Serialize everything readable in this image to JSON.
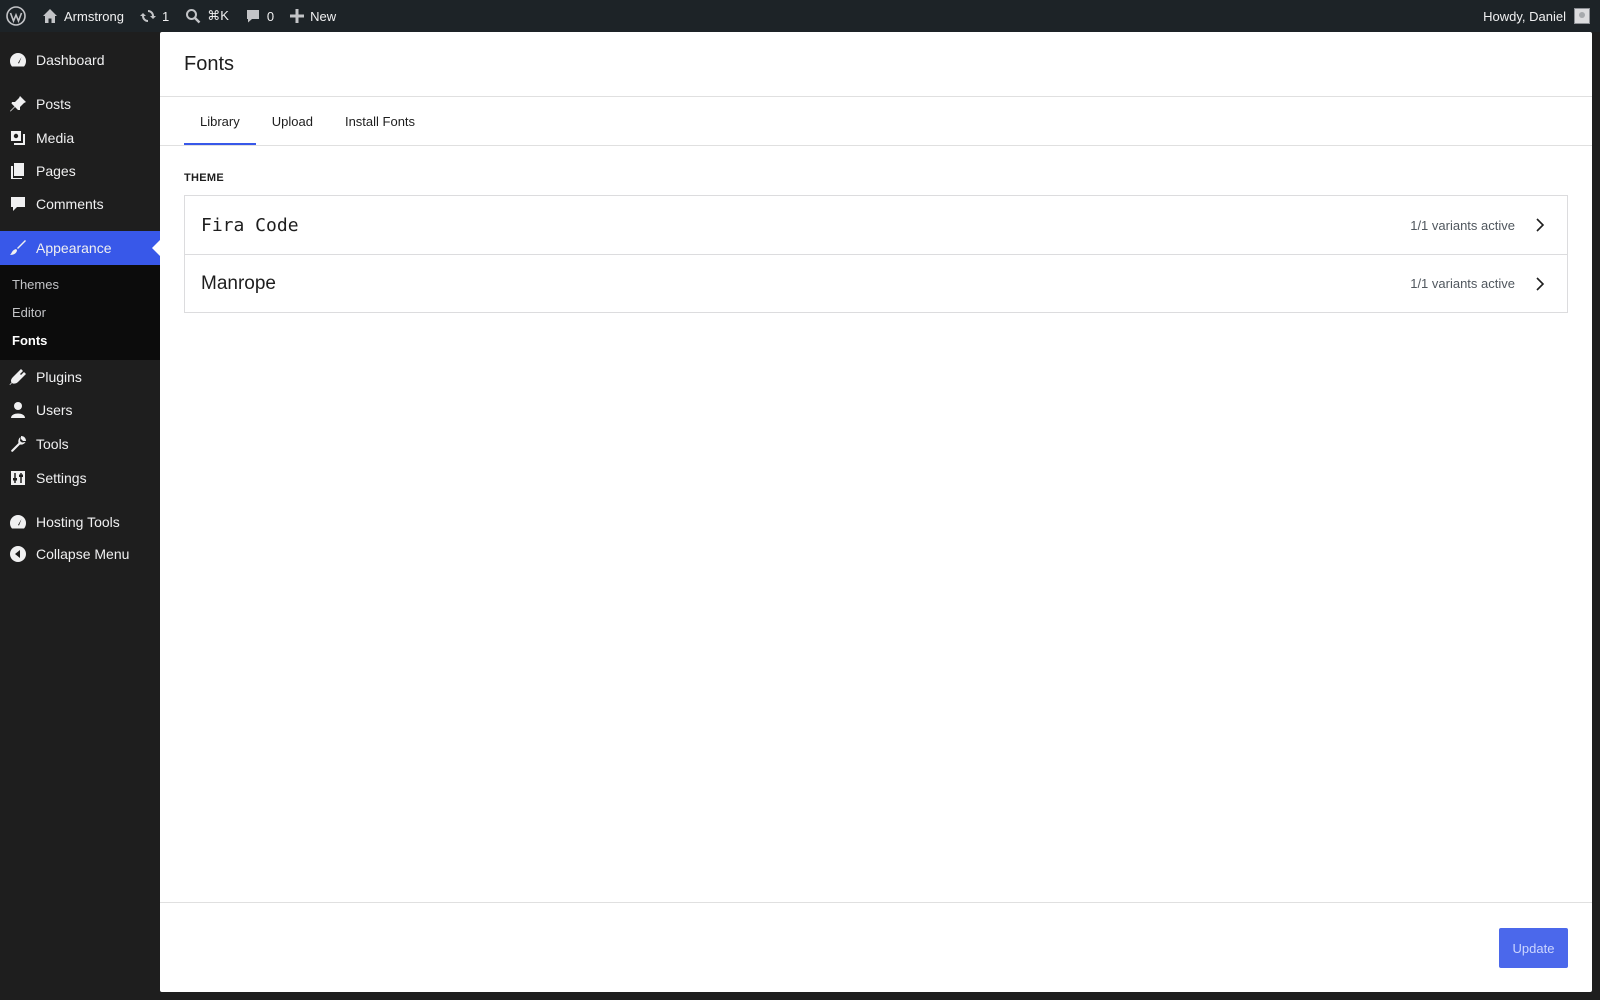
{
  "adminbar": {
    "site_name": "Armstrong",
    "updates_count": "1",
    "search_shortcut": "⌘K",
    "comments_count": "0",
    "new_label": "New",
    "greeting": "Howdy, Daniel"
  },
  "sidebar": {
    "items": [
      {
        "label": "Dashboard",
        "icon": "dashboard-icon"
      },
      {
        "label": "Posts",
        "icon": "pin-icon"
      },
      {
        "label": "Media",
        "icon": "media-icon"
      },
      {
        "label": "Pages",
        "icon": "pages-icon"
      },
      {
        "label": "Comments",
        "icon": "comment-icon"
      },
      {
        "label": "Appearance",
        "icon": "brush-icon",
        "active": true
      },
      {
        "label": "Plugins",
        "icon": "plugin-icon"
      },
      {
        "label": "Users",
        "icon": "user-icon"
      },
      {
        "label": "Tools",
        "icon": "wrench-icon"
      },
      {
        "label": "Settings",
        "icon": "sliders-icon"
      },
      {
        "label": "Hosting Tools",
        "icon": "gauge-icon"
      },
      {
        "label": "Collapse Menu",
        "icon": "collapse-icon"
      }
    ],
    "submenu": [
      {
        "label": "Themes"
      },
      {
        "label": "Editor"
      },
      {
        "label": "Fonts",
        "current": true
      }
    ]
  },
  "main": {
    "title": "Fonts",
    "tabs": [
      {
        "label": "Library",
        "selected": true
      },
      {
        "label": "Upload"
      },
      {
        "label": "Install Fonts"
      }
    ],
    "section_label": "THEME",
    "fonts": [
      {
        "name": "Fira Code",
        "status": "1/1 variants active"
      },
      {
        "name": "Manrope",
        "status": "1/1 variants active"
      }
    ],
    "update_label": "Update"
  },
  "colors": {
    "accent": "#3858e9",
    "adminbar_bg": "#1d2327",
    "sidebar_bg": "#1e1e1e",
    "submenu_bg": "#0c0c0c"
  }
}
